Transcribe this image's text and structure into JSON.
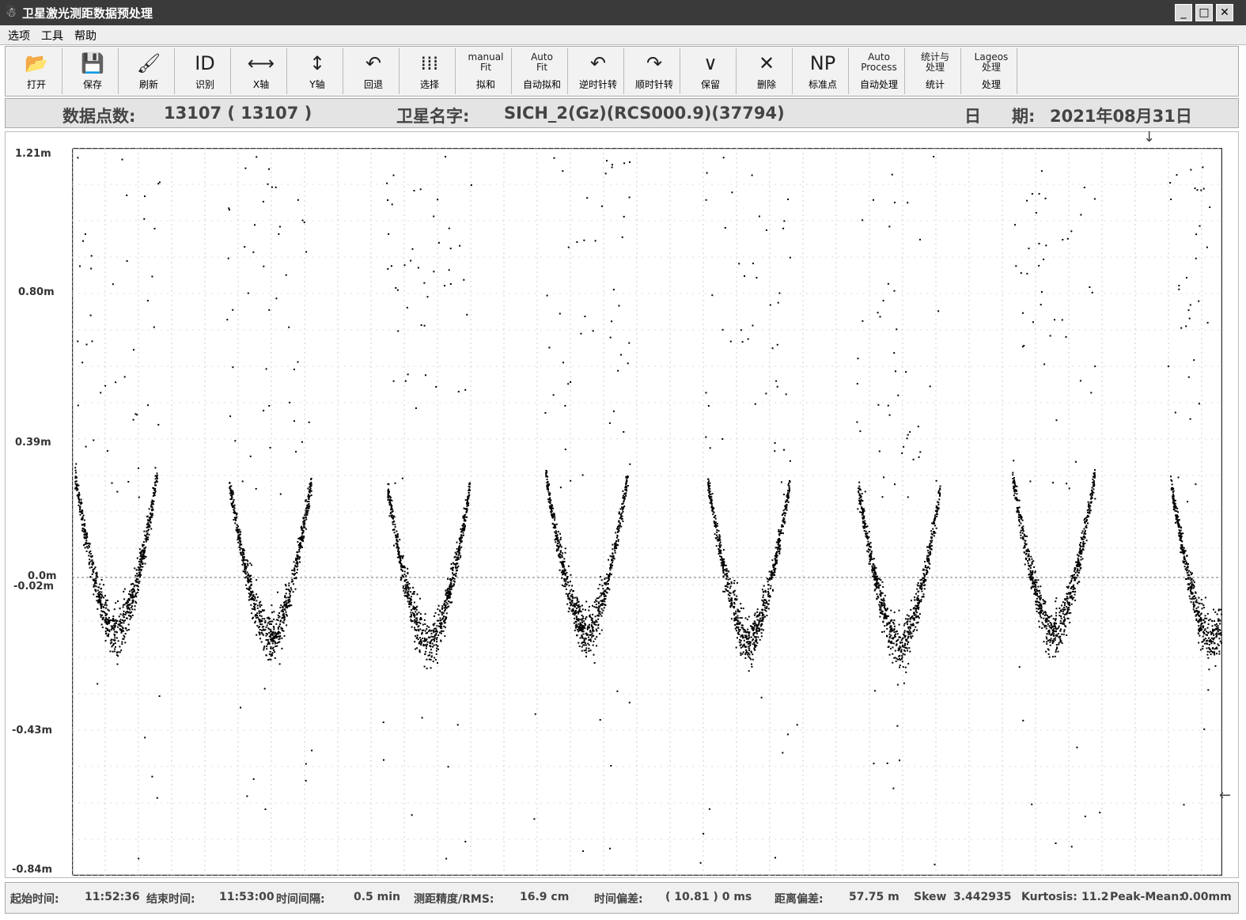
{
  "window": {
    "title": "卫星激光测距数据预处理",
    "icon": "app-icon",
    "buttons": [
      "minimize-icon",
      "maximize-icon",
      "close-icon"
    ]
  },
  "menu": [
    "选项",
    "工具",
    "帮助"
  ],
  "toolbar": [
    {
      "label": "打开",
      "icon": "folder-open-icon",
      "glyph": "📂"
    },
    {
      "label": "保存",
      "icon": "floppy-disk-icon",
      "glyph": "💾"
    },
    {
      "label": "刷新",
      "icon": "brush-icon",
      "glyph": "🖌"
    },
    {
      "label": "识别",
      "icon": "id-icon",
      "glyph": "ID"
    },
    {
      "label": "X轴",
      "icon": "horizontal-arrows-icon",
      "glyph": "⟷"
    },
    {
      "label": "Y轴",
      "icon": "vertical-arrows-icon",
      "glyph": "↕"
    },
    {
      "label": "回退",
      "icon": "undo-icon",
      "glyph": "↶"
    },
    {
      "label": "选择",
      "icon": "grid-select-icon",
      "glyph": "⁞⁞⁞"
    },
    {
      "label": "拟和",
      "icon": "manual-fit-icon",
      "glyph": "manual\nFit"
    },
    {
      "label": "自动拟和",
      "icon": "auto-fit-icon",
      "glyph": "Auto\nFit"
    },
    {
      "label": "逆时针转",
      "icon": "rotate-ccw-icon",
      "glyph": "↶"
    },
    {
      "label": "顺时针转",
      "icon": "rotate-cw-icon",
      "glyph": "↷"
    },
    {
      "label": "保留",
      "icon": "check-icon",
      "glyph": "∨"
    },
    {
      "label": "删除",
      "icon": "delete-x-icon",
      "glyph": "✕"
    },
    {
      "label": "标准点",
      "icon": "np-icon",
      "glyph": "NP"
    },
    {
      "label": "自动处理",
      "icon": "auto-process-icon",
      "glyph": "Auto\nProcess"
    },
    {
      "label": "统计",
      "icon": "statistics-icon",
      "glyph": "统计与\n处理"
    },
    {
      "label": "处理",
      "icon": "lageos-icon",
      "glyph": "Lageos\n处理"
    }
  ],
  "info": {
    "points_label": "数据点数:",
    "points_value": "13107 ( 13107 )",
    "satellite_label": "卫星名字:",
    "satellite_value": "SICH_2(Gz)(RCS000.9)(37794)",
    "date_label_1": "日",
    "date_label_2": "期:",
    "date_value": "2021年08月31日"
  },
  "plot": {
    "y_labels": [
      "1.21m",
      "0.80m",
      "0.39m",
      "0.0m",
      "-0.02m",
      "-0.43m",
      "-0.84m"
    ],
    "ylim": [
      -0.84,
      1.21
    ]
  },
  "status": {
    "start_label": "起始时间:",
    "start_value": "11:52:36",
    "end_label": "结束时间:",
    "end_value": "11:53:00",
    "interval_label": "时间间隔:",
    "interval_value": "0.5 min",
    "rms_label": "测距精度/RMS:",
    "rms_value": "16.9 cm",
    "time_bias_label": "时间偏差:",
    "time_bias_value": "( 10.81 ) 0 ms",
    "range_bias_label": "距离偏差:",
    "range_bias_value": "57.75 m",
    "skew_label": "Skew",
    "skew_value": "3.442935",
    "kurtosis_label": "Kurtosis:",
    "kurtosis_value": "11.2",
    "peak_label": "Peak-Mean:",
    "peak_value": "0.00mm"
  }
}
